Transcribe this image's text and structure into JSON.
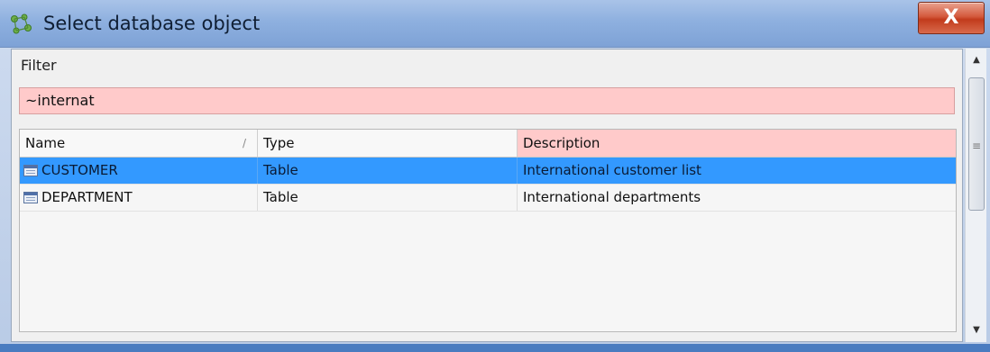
{
  "window": {
    "title": "Select database object",
    "title_icon": "database-objects-icon",
    "close_label": "X"
  },
  "filter": {
    "label": "Filter",
    "value": "~internat",
    "highlight_color": "#ffcaca"
  },
  "grid": {
    "columns": [
      {
        "key": "name",
        "label": "Name",
        "sort_indicator": "/"
      },
      {
        "key": "type",
        "label": "Type"
      },
      {
        "key": "description",
        "label": "Description"
      }
    ],
    "rows": [
      {
        "name": "CUSTOMER",
        "type": "Table",
        "description": "International customer list",
        "selected": true,
        "icon": "table-icon"
      },
      {
        "name": "DEPARTMENT",
        "type": "Table",
        "description": "International departments",
        "selected": false,
        "icon": "table-icon"
      }
    ],
    "selection_color": "#3399ff"
  },
  "scrollbar": {
    "up_glyph": "▲",
    "down_glyph": "▼",
    "grip_glyph": "≡"
  }
}
